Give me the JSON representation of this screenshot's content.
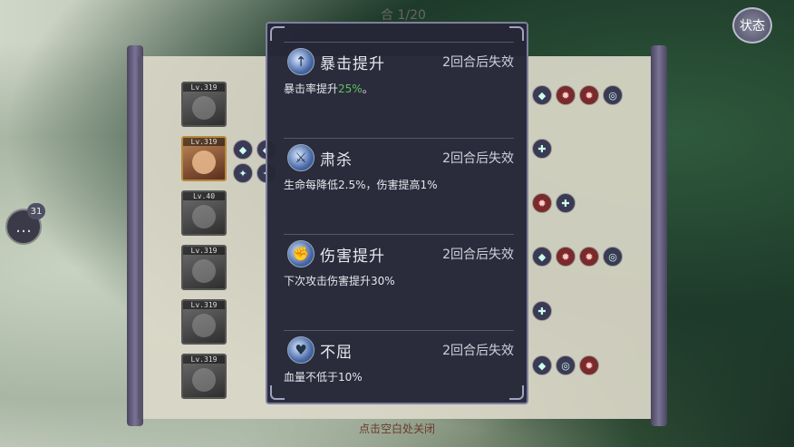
{
  "header": {
    "round_counter": "合 1/20",
    "status_label": "状态"
  },
  "chat": {
    "badge": "31",
    "icon": "chat-bubble-icon"
  },
  "heroes": [
    {
      "level": "Lv.319",
      "active": false
    },
    {
      "level": "Lv.319",
      "active": true
    },
    {
      "level": "Lv.40",
      "active": false
    },
    {
      "level": "Lv.319",
      "active": false
    },
    {
      "level": "Lv.319",
      "active": false
    },
    {
      "level": "Lv.319",
      "active": false
    }
  ],
  "popup": {
    "buffs": [
      {
        "name": "暴击提升",
        "duration": "2回合后失效",
        "desc_pre": "暴击率提升",
        "desc_hl": "25%",
        "desc_post": "。",
        "icon": "crit-up-icon"
      },
      {
        "name": "肃杀",
        "duration": "2回合后失效",
        "desc_pre": "生命每降低2.5%，伤害提高1%",
        "desc_hl": "",
        "desc_post": "",
        "icon": "slaughter-icon"
      },
      {
        "name": "伤害提升",
        "duration": "2回合后失效",
        "desc_pre": "下次攻击伤害提升30%",
        "desc_hl": "",
        "desc_post": "",
        "icon": "damage-up-icon"
      },
      {
        "name": "不屈",
        "duration": "2回合后失效",
        "desc_pre": "血量不低于10%",
        "desc_hl": "",
        "desc_post": "",
        "icon": "unyielding-icon"
      }
    ]
  },
  "footer": {
    "dismiss_text": "点击空白处关闭"
  },
  "colors": {
    "highlight": "#5ec25e",
    "popup_bg": "#252637"
  }
}
